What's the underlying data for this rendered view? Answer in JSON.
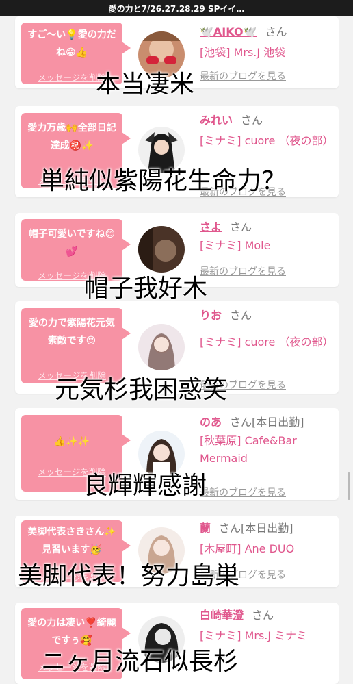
{
  "status_bar": {
    "title": "愛の力と7/26.27.28.29 SPイイ…"
  },
  "delete_label": "メッセージを削除",
  "blog_label": "最新のブログを見る",
  "san_label": "さん",
  "cards": [
    {
      "message": "すご〜い💡愛の力だね😁👍",
      "name": "🕊️AIKO🕊️",
      "attendance": "",
      "shop": "[池袋] Mrs.J 池袋"
    },
    {
      "message": "愛力万歳🙌全部日記達成㊗️✨",
      "name": "みれい",
      "attendance": "",
      "shop": "[ミナミ] cuore （夜の部）"
    },
    {
      "message": "帽子可愛いですね😊💕",
      "name": "さよ",
      "attendance": "",
      "shop": "[ミナミ] Mole"
    },
    {
      "message": "愛の力で紫陽花元気素敵です😍",
      "name": "りお",
      "attendance": "",
      "shop": "[ミナミ] cuore （夜の部）"
    },
    {
      "message": "👍✨✨",
      "name": "のあ",
      "attendance": "[本日出勤]",
      "shop": "[秋葉原] Cafe&Bar Mermaid"
    },
    {
      "message": "美脚代表さきさん✨見習います🥳",
      "name": "蘭",
      "attendance": "[本日出勤]",
      "shop": "[木屋町] Ane DUO"
    },
    {
      "message": "愛の力は凄い❣️綺麗ですぅ🥰",
      "name": "白崎華澄",
      "attendance": "",
      "shop": "[ミナミ] Mrs.J ミナミ"
    }
  ],
  "captions": [
    "本当凄米",
    "単純似紫陽花生命力？",
    "帽子我好木",
    "元気杉我困惑笑",
    "良輝輝感謝",
    "美脚代表！努力島巣",
    "ニヶ月流石似長杉"
  ],
  "colors": {
    "bubble": "#f792a4",
    "name": "#e0578d",
    "topbar": "#1c1c1c",
    "background": "#f2f2f2"
  }
}
